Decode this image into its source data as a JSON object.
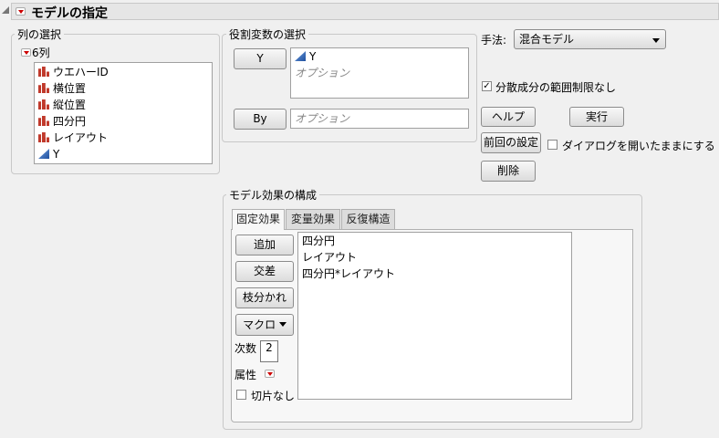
{
  "title": "モデルの指定",
  "columns": {
    "label": "列の選択",
    "count": "6列",
    "items": [
      {
        "name": "ウエハーID",
        "type": "nominal"
      },
      {
        "name": "横位置",
        "type": "nominal"
      },
      {
        "name": "縦位置",
        "type": "nominal"
      },
      {
        "name": "四分円",
        "type": "nominal"
      },
      {
        "name": "レイアウト",
        "type": "nominal"
      },
      {
        "name": "Y",
        "type": "continuous"
      }
    ]
  },
  "roles": {
    "label": "役割変数の選択",
    "y_button": "Y",
    "y_value": "Y",
    "y_placeholder": "オプション",
    "by_button": "By",
    "by_placeholder": "オプション"
  },
  "method": {
    "label": "手法:",
    "value": "混合モデル"
  },
  "unbounded_variance": {
    "label": "分散成分の範囲制限なし",
    "checked": true
  },
  "buttons": {
    "help": "ヘルプ",
    "run": "実行",
    "recall": "前回の設定",
    "remove": "削除"
  },
  "keep_dialog": {
    "label": "ダイアログを開いたままにする",
    "checked": false
  },
  "effects": {
    "label": "モデル効果の構成",
    "tabs": [
      "固定効果",
      "変量効果",
      "反復構造"
    ],
    "active_tab": 0,
    "add": "追加",
    "cross": "交差",
    "nest": "枝分かれ",
    "macros": "マクロ",
    "degree_label": "次数",
    "degree": "2",
    "attributes": "属性",
    "no_intercept": {
      "label": "切片なし",
      "checked": false
    },
    "list": [
      "四分円",
      "レイアウト",
      "四分円*レイアウト"
    ]
  }
}
